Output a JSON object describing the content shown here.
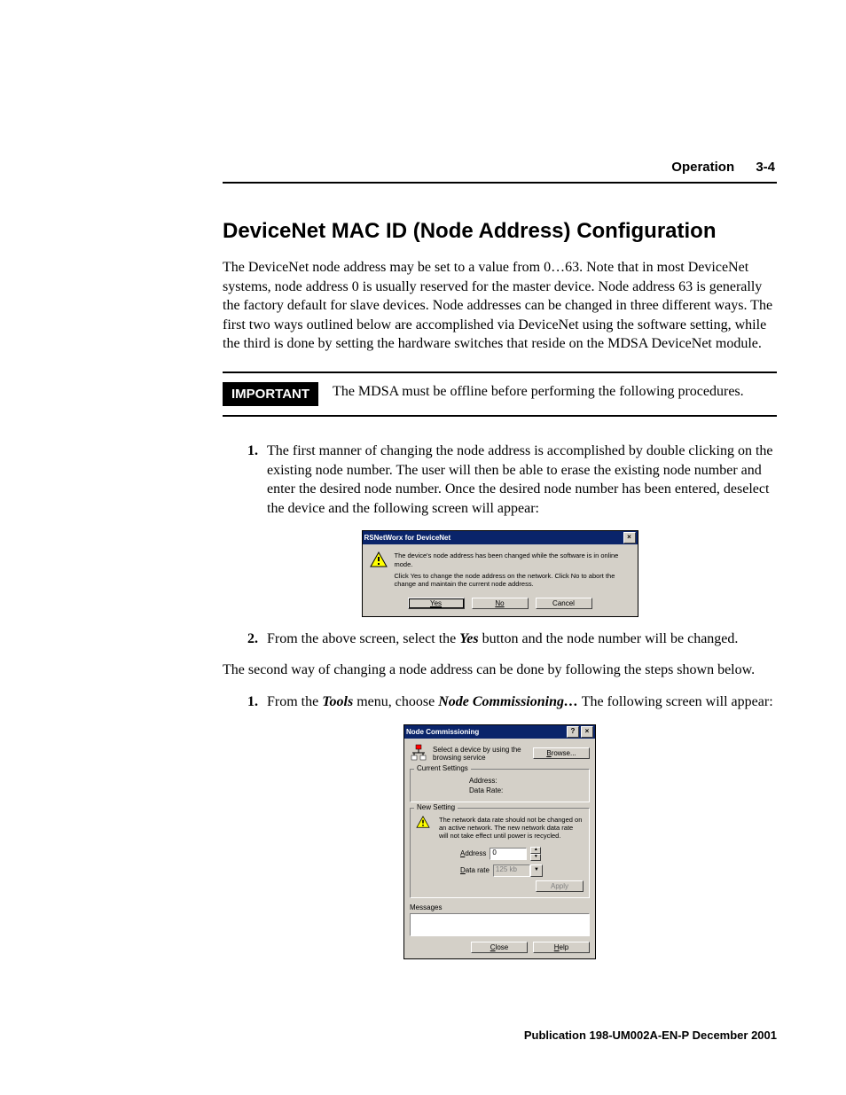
{
  "header": {
    "section": "Operation",
    "page": "3-4"
  },
  "title": "DeviceNet MAC ID (Node Address) Configuration",
  "intro": "The DeviceNet node address may be set to a value from 0…63. Note that in most DeviceNet systems, node address 0 is usually reserved for the master device. Node address 63 is generally the factory default for slave devices. Node addresses can be changed in three different ways. The first two ways outlined below are accomplished via DeviceNet using the software setting, while the third is done by setting the hardware switches that reside on the MDSA DeviceNet module.",
  "important": {
    "label": "IMPORTANT",
    "text": "The MDSA must be offline before performing the following procedures."
  },
  "steps_a": {
    "s1": "The first manner of changing the node address is accomplished by double clicking on the existing node number. The user will then be able to erase the existing node number and enter the desired node number. Once the desired node number has been entered, deselect the device and the following screen will appear:",
    "s2_pre": "From the above screen, select the ",
    "s2_em": "Yes",
    "s2_post": " button and the node number will be changed."
  },
  "dialog1": {
    "title": "RSNetWorx for DeviceNet",
    "line1": "The device's node address has been changed while the software is in online mode.",
    "line2": "Click Yes to change the node address on the network.  Click No to abort the change and maintain the current node address.",
    "btn_yes": "Yes",
    "btn_no": "No",
    "btn_cancel": "Cancel"
  },
  "second_way": "The second way of changing a node address can be done by following the steps shown below.",
  "steps_b": {
    "s1_pre": "From the ",
    "s1_em1": "Tools",
    "s1_mid": " menu, choose ",
    "s1_em2": "Node Commissioning…",
    "s1_post": " The following screen will appear:"
  },
  "dialog2": {
    "title": "Node Commissioning",
    "select_text": "Select a device by using the browsing service",
    "browse": "Browse...",
    "current_settings": "Current Settings",
    "address_label": "Address:",
    "datarate_label": "Data Rate:",
    "new_setting": "New Setting",
    "warn": "The network data rate should not be changed on an active network. The new network data rate will not take effect until power is recycled.",
    "field_address": "Address",
    "address_value": "0",
    "field_datarate": "Data rate",
    "datarate_value": "125 kb",
    "apply": "Apply",
    "messages": "Messages",
    "close": "Close",
    "help": "Help"
  },
  "footer": "Publication 198-UM002A-EN-P  December 2001"
}
